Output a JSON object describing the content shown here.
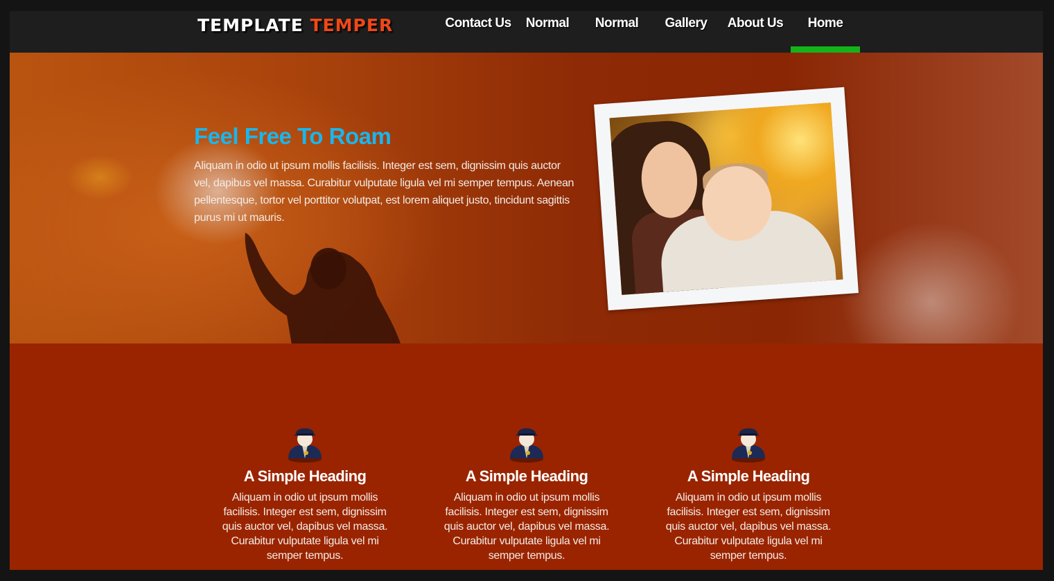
{
  "logo": {
    "word1": "TEMPLATE",
    "word2": "TEMPER"
  },
  "nav": {
    "items": [
      {
        "label": "Contact Us"
      },
      {
        "label": "Normal"
      },
      {
        "label": "Normal"
      },
      {
        "label": "Gallery"
      },
      {
        "label": "About Us"
      },
      {
        "label": "Home"
      }
    ],
    "active": "Home"
  },
  "hero": {
    "title": "Feel Free To Roam",
    "text": "Aliquam in odio ut ipsum mollis facilisis. Integer est sem, dignissim quis auctor vel, dapibus vel massa. Curabitur vulputate ligula vel mi semper tempus. Aenean pellentesque, tortor vel porttitor volutpat, est lorem aliquet justo, tincidunt sagittis purus mi ut mauris."
  },
  "features": [
    {
      "icon": "user-icon",
      "heading": "A Simple Heading",
      "text": "Aliquam in odio ut ipsum mollis facilisis. Integer est sem, dignissim quis auctor vel, dapibus vel massa. Curabitur vulputate ligula vel mi semper tempus."
    },
    {
      "icon": "user-icon",
      "heading": "A Simple Heading",
      "text": "Aliquam in odio ut ipsum mollis facilisis. Integer est sem, dignissim quis auctor vel, dapibus vel massa. Curabitur vulputate ligula vel mi semper tempus."
    },
    {
      "icon": "user-icon",
      "heading": "A Simple Heading",
      "text": "Aliquam in odio ut ipsum mollis facilisis. Integer est sem, dignissim quis auctor vel, dapibus vel massa. Curabitur vulputate ligula vel mi semper tempus."
    }
  ],
  "colors": {
    "header_bg": "#1e1e1e",
    "logo_accent": "#f04818",
    "nav_active_bar": "#15b31a",
    "hero_title": "#19b6ee",
    "section_bg": "#9a2400"
  }
}
